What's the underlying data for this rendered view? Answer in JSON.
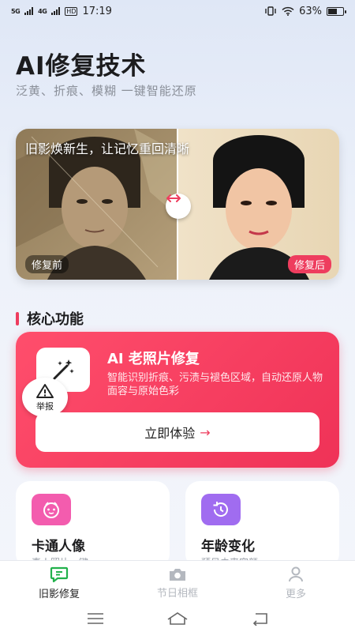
{
  "status": {
    "network1": "5G",
    "network2": "4G",
    "hd": "HD",
    "time": "17:19",
    "battery": "63%",
    "battery_level": 0.63
  },
  "header": {
    "title": "AI修复技术",
    "subtitle": "泛黄、折痕、模糊 一键智能还原"
  },
  "compare": {
    "caption": "旧影焕新生，让记忆重回清晰",
    "before_label": "修复前",
    "after_label": "修复后"
  },
  "section": {
    "title": "核心功能"
  },
  "feature": {
    "title": "AI 老照片修复",
    "description": "智能识别折痕、污渍与褪色区域，自动还原人物面容与原始色彩",
    "button_label": "立即体验",
    "arrow": "→",
    "report_label": "举报"
  },
  "cards": [
    {
      "title": "卡通人像",
      "subtitle": "真人照片一键",
      "icon": "cartoon-face-icon",
      "color": "#f35cae"
    },
    {
      "title": "年龄变化",
      "subtitle": "预见未来容颜",
      "icon": "history-clock-icon",
      "color": "#a06cf0"
    }
  ],
  "tabs": [
    {
      "label": "旧影修复",
      "icon": "chat-bubble-icon",
      "active": true
    },
    {
      "label": "节日相框",
      "icon": "camera-icon",
      "active": false
    },
    {
      "label": "更多",
      "icon": "person-icon",
      "active": false
    }
  ],
  "colors": {
    "accent": "#ee3d5e",
    "active_tab": "#22b14c"
  }
}
